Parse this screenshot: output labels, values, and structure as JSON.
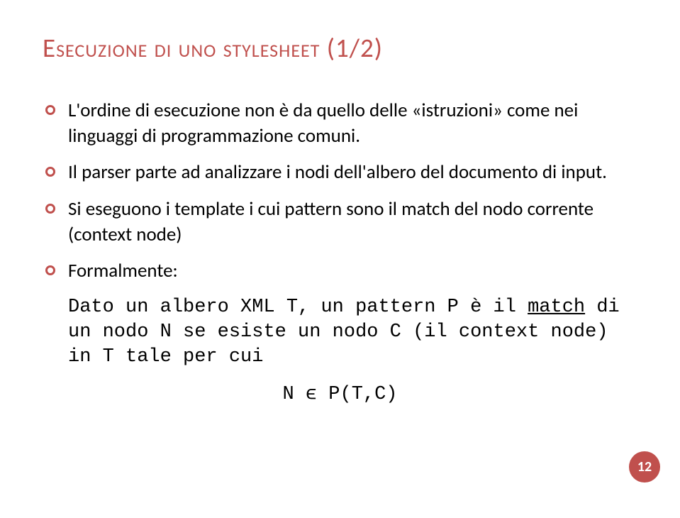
{
  "title": "Esecuzione di uno stylesheet (1/2)",
  "bullets": [
    "L'ordine di esecuzione non è da quello delle «istruzioni» come nei linguaggi di programmazione comuni.",
    "Il parser parte ad analizzare i nodi dell'albero del documento di input.",
    "Si eseguono i template i cui pattern sono il match del nodo corrente (context node)",
    "Formalmente:"
  ],
  "formal": {
    "line1_pre": "Dato un albero XML T, un pattern P è il ",
    "line1_match": "match",
    "line1_post": " di un nodo N se esiste un nodo C (il context node) in T tale per cui"
  },
  "formula": "N ϵ P(T,C)",
  "page_number": "12"
}
